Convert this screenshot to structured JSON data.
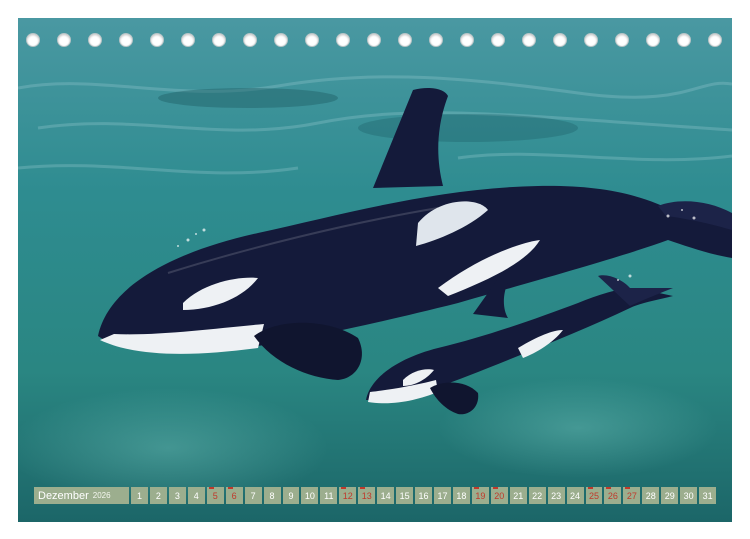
{
  "calendar": {
    "month": "Dezember",
    "year": "2026",
    "days": [
      {
        "n": "1",
        "red": false
      },
      {
        "n": "2",
        "red": false
      },
      {
        "n": "3",
        "red": false
      },
      {
        "n": "4",
        "red": false
      },
      {
        "n": "5",
        "red": true
      },
      {
        "n": "6",
        "red": true
      },
      {
        "n": "7",
        "red": false
      },
      {
        "n": "8",
        "red": false
      },
      {
        "n": "9",
        "red": false
      },
      {
        "n": "10",
        "red": false
      },
      {
        "n": "11",
        "red": false
      },
      {
        "n": "12",
        "red": true
      },
      {
        "n": "13",
        "red": true
      },
      {
        "n": "14",
        "red": false
      },
      {
        "n": "15",
        "red": false
      },
      {
        "n": "16",
        "red": false
      },
      {
        "n": "17",
        "red": false
      },
      {
        "n": "18",
        "red": false
      },
      {
        "n": "19",
        "red": true
      },
      {
        "n": "20",
        "red": true
      },
      {
        "n": "21",
        "red": false
      },
      {
        "n": "22",
        "red": false
      },
      {
        "n": "23",
        "red": false
      },
      {
        "n": "24",
        "red": false
      },
      {
        "n": "25",
        "red": true
      },
      {
        "n": "26",
        "red": true
      },
      {
        "n": "27",
        "red": true
      },
      {
        "n": "28",
        "red": false
      },
      {
        "n": "29",
        "red": false
      },
      {
        "n": "30",
        "red": false
      },
      {
        "n": "31",
        "red": false
      }
    ]
  },
  "binding_holes": 23,
  "colors": {
    "strip": "#9cae8e",
    "weekend_red": "#c0392b",
    "water": "#2f8a8e",
    "orca_black": "#141a3a",
    "orca_white": "#f2f4f6"
  },
  "photo": {
    "subject": "orca-mother-and-calf"
  }
}
